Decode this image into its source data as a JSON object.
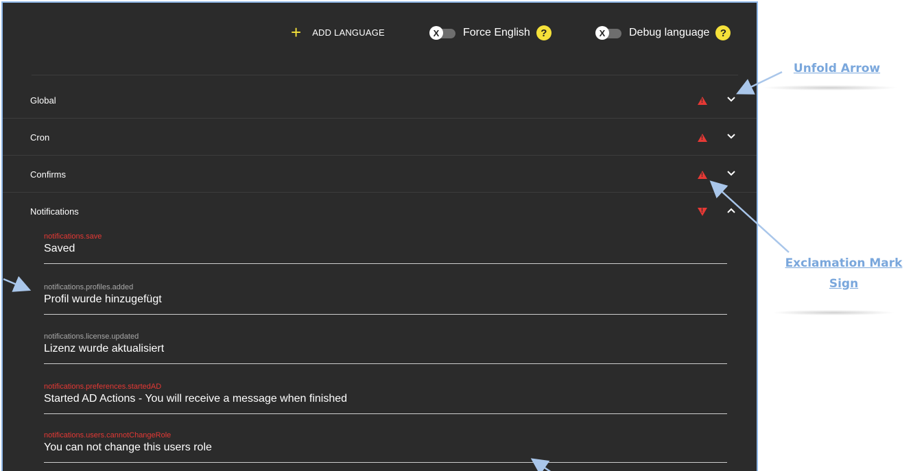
{
  "toolbar": {
    "add_language_label": "ADD LANGUAGE",
    "force_english_label": "Force English",
    "debug_language_label": "Debug language",
    "toggle_knob_glyph": "X",
    "help_glyph": "?"
  },
  "sections": [
    {
      "title": "Global",
      "expanded": false,
      "warning": true
    },
    {
      "title": "Cron",
      "expanded": false,
      "warning": true
    },
    {
      "title": "Confirms",
      "expanded": false,
      "warning": true
    },
    {
      "title": "Notifications",
      "expanded": true,
      "warning": true
    }
  ],
  "fields": [
    {
      "key": "notifications.save",
      "value": "Saved",
      "missing": true
    },
    {
      "key": "notifications.profiles.added",
      "value": "Profil wurde hinzugefügt",
      "missing": false
    },
    {
      "key": "notifications.license.updated",
      "value": "Lizenz wurde aktualisiert",
      "missing": false
    },
    {
      "key": "notifications.preferences.startedAD",
      "value": "Started AD Actions - You will receive a message when finished",
      "missing": true
    },
    {
      "key": "notifications.users.cannotChangeRole",
      "value": "You can not change this users role",
      "missing": true
    }
  ],
  "annotations": {
    "unfold_arrow": "Unfold Arrow",
    "exclamation_line1": "Exclamation Mark",
    "exclamation_line2": "Sign"
  },
  "colors": {
    "panel_bg": "#2b2b2b",
    "accent_yellow": "#f5e13a",
    "warning_red": "#e53935",
    "annotation_blue": "#7aa7dc"
  }
}
